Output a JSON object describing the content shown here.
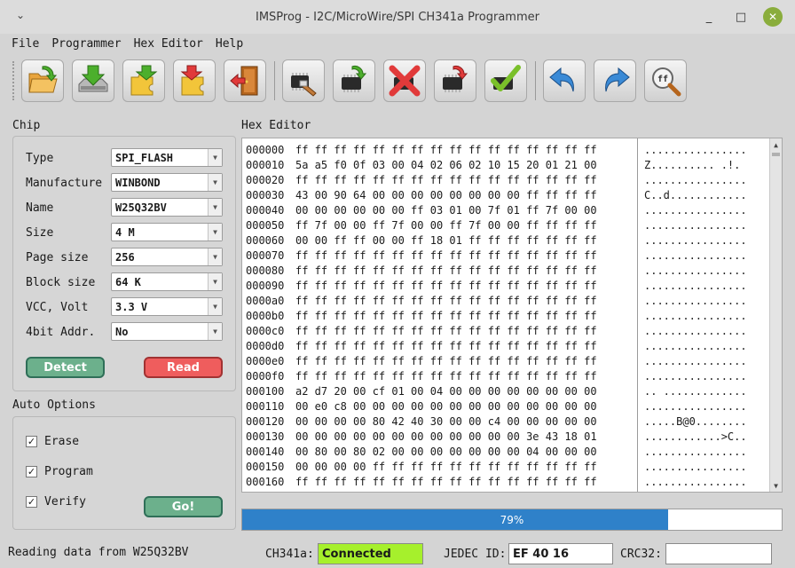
{
  "window": {
    "title": "IMSProg - I2C/MicroWire/SPI CH341a Programmer",
    "minimize_glyph": "_",
    "maximize_glyph": "□",
    "close_glyph": "✕"
  },
  "menu": [
    "File",
    "Programmer",
    "Hex Editor",
    "Help"
  ],
  "toolbar": {
    "icons": [
      "open-file-icon",
      "save-file-icon",
      "import-puzzle-icon",
      "export-puzzle-icon",
      "exit-door-icon",
      "erase-chip-icon",
      "write-chip-icon",
      "stop-erase-icon",
      "revert-chip-icon",
      "verify-check-icon",
      "undo-arrow-icon",
      "redo-arrow-icon",
      "find-ff-icon"
    ]
  },
  "chip": {
    "heading": "Chip",
    "fields": [
      {
        "label": "Type",
        "value": "SPI_FLASH"
      },
      {
        "label": "Manufacture",
        "value": "WINBOND"
      },
      {
        "label": "Name",
        "value": "W25Q32BV"
      },
      {
        "label": "Size",
        "value": "4 M"
      },
      {
        "label": "Page size",
        "value": "256"
      },
      {
        "label": "Block size",
        "value": "64 K"
      },
      {
        "label": "VCC, Volt",
        "value": "3.3 V"
      },
      {
        "label": "4bit Addr.",
        "value": "No"
      }
    ],
    "detect_label": "Detect",
    "read_label": "Read"
  },
  "auto_options": {
    "heading": "Auto Options",
    "items": [
      {
        "label": "Erase",
        "checked": true
      },
      {
        "label": "Program",
        "checked": true
      },
      {
        "label": "Verify",
        "checked": true
      }
    ],
    "go_label": "Go!"
  },
  "hex_editor": {
    "heading": "Hex Editor",
    "rows": [
      {
        "addr": "000000",
        "bytes": "ff ff ff ff ff ff ff ff ff ff ff ff ff ff ff ff",
        "ascii": "................"
      },
      {
        "addr": "000010",
        "bytes": "5a a5 f0 0f 03 00 04 02 06 02 10 15 20 01 21 00",
        "ascii": "Z.......... .!."
      },
      {
        "addr": "000020",
        "bytes": "ff ff ff ff ff ff ff ff ff ff ff ff ff ff ff ff",
        "ascii": "................"
      },
      {
        "addr": "000030",
        "bytes": "43 00 90 64 00 00 00 00 00 00 00 00 ff ff ff ff",
        "ascii": "C..d............"
      },
      {
        "addr": "000040",
        "bytes": "00 00 00 00 00 00 ff 03 01 00 7f 01 ff 7f 00 00",
        "ascii": "................"
      },
      {
        "addr": "000050",
        "bytes": "ff 7f 00 00 ff 7f 00 00 ff 7f 00 00 ff ff ff ff",
        "ascii": "................"
      },
      {
        "addr": "000060",
        "bytes": "00 00 ff ff 00 00 ff 18 01 ff ff ff ff ff ff ff",
        "ascii": "................"
      },
      {
        "addr": "000070",
        "bytes": "ff ff ff ff ff ff ff ff ff ff ff ff ff ff ff ff",
        "ascii": "................"
      },
      {
        "addr": "000080",
        "bytes": "ff ff ff ff ff ff ff ff ff ff ff ff ff ff ff ff",
        "ascii": "................"
      },
      {
        "addr": "000090",
        "bytes": "ff ff ff ff ff ff ff ff ff ff ff ff ff ff ff ff",
        "ascii": "................"
      },
      {
        "addr": "0000a0",
        "bytes": "ff ff ff ff ff ff ff ff ff ff ff ff ff ff ff ff",
        "ascii": "................"
      },
      {
        "addr": "0000b0",
        "bytes": "ff ff ff ff ff ff ff ff ff ff ff ff ff ff ff ff",
        "ascii": "................"
      },
      {
        "addr": "0000c0",
        "bytes": "ff ff ff ff ff ff ff ff ff ff ff ff ff ff ff ff",
        "ascii": "................"
      },
      {
        "addr": "0000d0",
        "bytes": "ff ff ff ff ff ff ff ff ff ff ff ff ff ff ff ff",
        "ascii": "................"
      },
      {
        "addr": "0000e0",
        "bytes": "ff ff ff ff ff ff ff ff ff ff ff ff ff ff ff ff",
        "ascii": "................"
      },
      {
        "addr": "0000f0",
        "bytes": "ff ff ff ff ff ff ff ff ff ff ff ff ff ff ff ff",
        "ascii": "................"
      },
      {
        "addr": "000100",
        "bytes": "a2 d7 20 00 cf 01 00 04 00 00 00 00 00 00 00 00",
        "ascii": ".. ............."
      },
      {
        "addr": "000110",
        "bytes": "00 e0 c8 00 00 00 00 00 00 00 00 00 00 00 00 00",
        "ascii": "................"
      },
      {
        "addr": "000120",
        "bytes": "00 00 00 00 80 42 40 30 00 00 c4 00 00 00 00 00",
        "ascii": ".....B@0........"
      },
      {
        "addr": "000130",
        "bytes": "00 00 00 00 00 00 00 00 00 00 00 00 3e 43 18 01",
        "ascii": "............>C.."
      },
      {
        "addr": "000140",
        "bytes": "00 80 00 80 02 00 00 00 00 00 00 00 04 00 00 00",
        "ascii": "................"
      },
      {
        "addr": "000150",
        "bytes": "00 00 00 00 ff ff ff ff ff ff ff ff ff ff ff ff",
        "ascii": "................"
      },
      {
        "addr": "000160",
        "bytes": "ff ff ff ff ff ff ff ff ff ff ff ff ff ff ff ff",
        "ascii": "................"
      }
    ]
  },
  "progress": {
    "value": 0.79,
    "label": "79%",
    "color": "#2f81c9"
  },
  "status": {
    "message": "Reading data from W25Q32BV",
    "ch341a_label": "CH341a:",
    "ch341a_value": "Connected",
    "ch341a_color": "#a6f02c",
    "jedec_label": "JEDEC ID:",
    "jedec_value": "EF 40 16",
    "crc_label": "CRC32:",
    "crc_value": ""
  }
}
